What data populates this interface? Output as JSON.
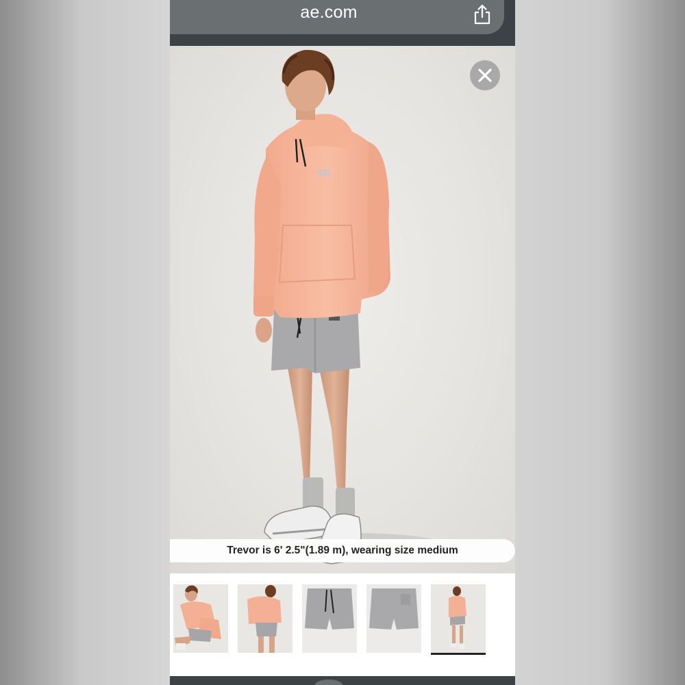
{
  "browser": {
    "url": "ae.com",
    "share_icon": "share-icon"
  },
  "product_viewer": {
    "close_icon": "close-icon",
    "caption": "Trevor is 6' 2.5\"(1.89 m), wearing size medium",
    "thumbnails": [
      {
        "name": "seated-pose",
        "selected": false
      },
      {
        "name": "back-view",
        "selected": false
      },
      {
        "name": "shorts-front-flat",
        "selected": false
      },
      {
        "name": "shorts-back-flat",
        "selected": false
      },
      {
        "name": "full-body-front",
        "selected": true
      }
    ]
  },
  "colors": {
    "hoodie": "#f6b69b",
    "shorts": "#a7a7a9",
    "browser_chrome": "#3d4246",
    "url_pill": "#6a6f72"
  }
}
